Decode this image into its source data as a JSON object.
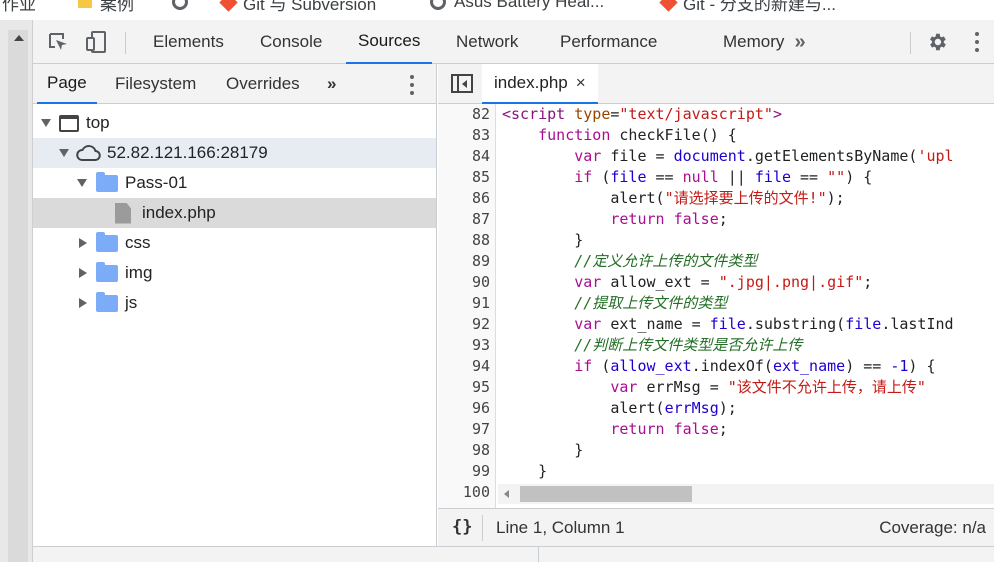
{
  "bookmarks": [
    {
      "label": "作业",
      "icon": "none"
    },
    {
      "label": "案例",
      "icon": "folder-icon"
    },
    {
      "label": "",
      "icon": "circle-icon"
    },
    {
      "label": "Git 与 Subversion",
      "icon": "git-icon"
    },
    {
      "label": "Asus Battery Heal...",
      "icon": "circle-icon"
    },
    {
      "label": "Git - 分支的新建与...",
      "icon": "git-icon"
    }
  ],
  "toolbar": {
    "tabs": [
      "Elements",
      "Console",
      "Sources",
      "Network",
      "Performance",
      "Memory"
    ],
    "active_tab": "Sources",
    "more": "»"
  },
  "navigator": {
    "tabs": [
      "Page",
      "Filesystem",
      "Overrides"
    ],
    "more": "»",
    "tree": {
      "top": "top",
      "host": "52.82.121.166:28179",
      "pass": "Pass-01",
      "file": "index.php",
      "css": "css",
      "img": "img",
      "js": "js"
    }
  },
  "editor": {
    "tab_label": "index.php",
    "close": "×",
    "line_numbers": [
      "82",
      "83",
      "84",
      "85",
      "86",
      "87",
      "88",
      "89",
      "90",
      "91",
      "92",
      "93",
      "94",
      "95",
      "96",
      "97",
      "98",
      "99",
      "100"
    ]
  },
  "status": {
    "braces": "{}",
    "position": "Line 1, Column 1",
    "coverage": "Coverage: n/a"
  },
  "colors": {
    "accent": "#1a73e8",
    "toolbar_bg": "#f3f3f3",
    "folder": "#7cacf8",
    "keyword": "#aa0d91",
    "string": "#c41a16",
    "comment": "#236e25"
  }
}
